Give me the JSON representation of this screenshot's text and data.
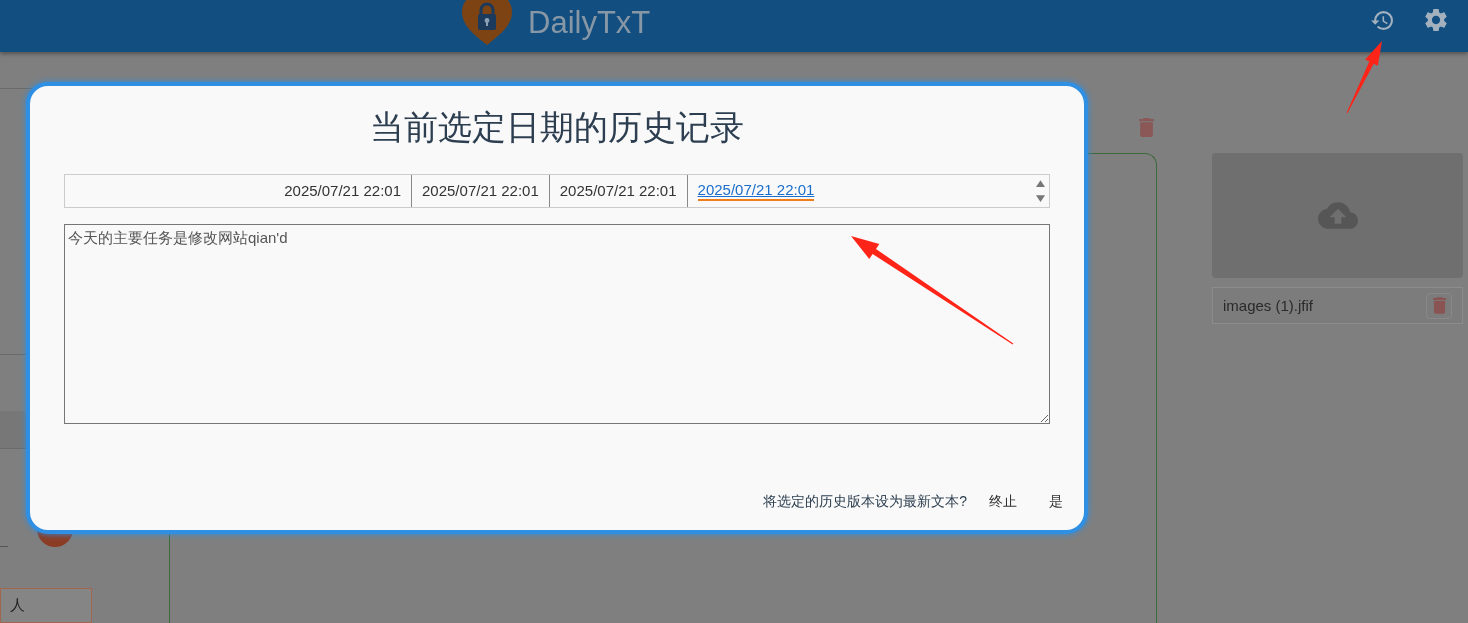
{
  "header": {
    "app_name": "DailyTxT"
  },
  "sidebar": {
    "field_value": "人"
  },
  "attachments": [
    {
      "file_name": "images (1).jfif"
    }
  ],
  "dialog": {
    "title": "当前选定日期的历史记录",
    "versions": [
      {
        "time": "2025/07/21 22:01",
        "selected": false
      },
      {
        "time": "2025/07/21 22:01",
        "selected": false
      },
      {
        "time": "2025/07/21 22:01",
        "selected": false
      },
      {
        "time": "2025/07/21 22:01",
        "selected": true
      }
    ],
    "content": "今天的主要任务是修改网站qian'd",
    "prompt": "将选定的历史版本设为最新文本?",
    "buttons": [
      "终止",
      "是"
    ]
  }
}
